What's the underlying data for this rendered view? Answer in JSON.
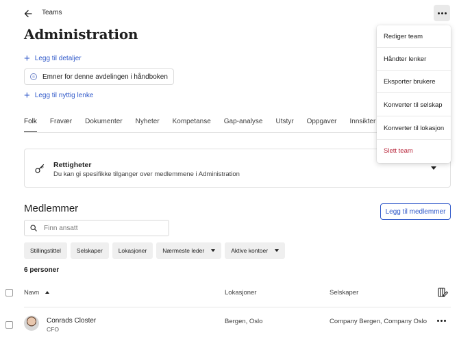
{
  "header": {
    "breadcrumb": "Teams",
    "title": "Administration"
  },
  "actions": {
    "add_details": "Legg til detaljer",
    "handbook_chip": "Emner for denne avdelingen i håndboken",
    "add_link": "Legg til nyttig lenke"
  },
  "tabs": [
    "Folk",
    "Fravær",
    "Dokumenter",
    "Nyheter",
    "Kompetanse",
    "Gap-analyse",
    "Utstyr",
    "Oppgaver",
    "Innsikter"
  ],
  "active_tab": "Folk",
  "rights": {
    "title": "Rettigheter",
    "description": "Du kan gi spesifikke tilganger over medlemmene i Administration"
  },
  "members": {
    "title": "Medlemmer",
    "add_button": "Legg til medlemmer",
    "search_placeholder": "Finn ansatt",
    "filters": [
      {
        "label": "Stillingstittel",
        "dropdown": false
      },
      {
        "label": "Selskaper",
        "dropdown": false
      },
      {
        "label": "Lokasjoner",
        "dropdown": false
      },
      {
        "label": "Nærmeste leder",
        "dropdown": true
      },
      {
        "label": "Aktive kontoer",
        "dropdown": true
      }
    ],
    "count": "6 personer",
    "columns": {
      "name": "Navn",
      "locations": "Lokasjoner",
      "companies": "Selskaper"
    },
    "rows": [
      {
        "name": "Conrads Closter",
        "role": "CFO",
        "locations": "Bergen, Oslo",
        "companies": "Company Bergen, Company Oslo"
      }
    ]
  },
  "menu": {
    "items": [
      "Rediger team",
      "Håndter lenker",
      "Eksporter brukere",
      "Konverter til selskap",
      "Konverter til lokasjon",
      "Slett team"
    ]
  },
  "colors": {
    "accent": "#2f58c9",
    "danger": "#b8263b",
    "text": "#1f1f1f"
  },
  "icons": [
    "back-arrow-icon",
    "more-icon",
    "plus-icon",
    "chat-bubble-icon",
    "key-icon",
    "chevron-down-icon",
    "search-icon",
    "sort-up-icon",
    "columns-edit-icon"
  ]
}
